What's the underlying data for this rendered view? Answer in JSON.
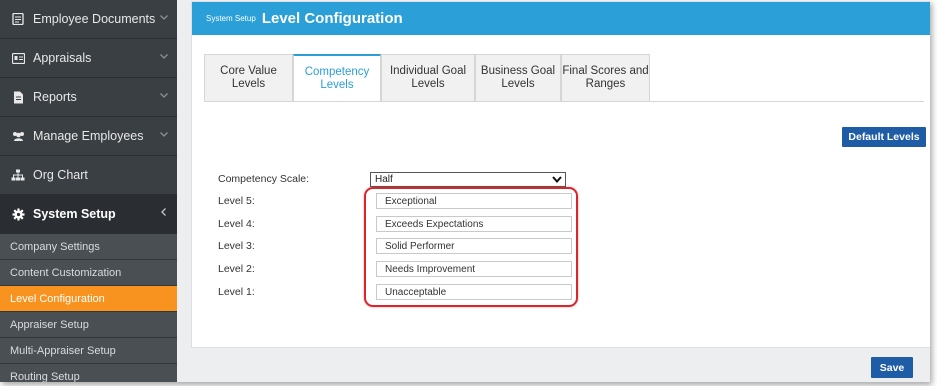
{
  "sidebar": {
    "items": [
      {
        "label": "Employee Documents",
        "icon": "document-icon",
        "expandable": true
      },
      {
        "label": "Appraisals",
        "icon": "id-card-icon",
        "expandable": true
      },
      {
        "label": "Reports",
        "icon": "report-icon",
        "expandable": true
      },
      {
        "label": "Manage Employees",
        "icon": "users-icon",
        "expandable": true
      },
      {
        "label": "Org Chart",
        "icon": "org-chart-icon",
        "expandable": false
      },
      {
        "label": "System Setup",
        "icon": "gear-icon",
        "expandable": true,
        "active": true
      }
    ],
    "sub_items": [
      "Company Settings",
      "Content Customization",
      "Level Configuration",
      "Appraiser Setup",
      "Multi-Appraiser Setup",
      "Routing Setup"
    ],
    "selected_sub_item": "Level Configuration"
  },
  "header": {
    "breadcrumb": "System Setup",
    "title": "Level Configuration"
  },
  "tabs": [
    {
      "line1": "Core Value",
      "line2": "Levels"
    },
    {
      "line1": "Competency",
      "line2": "Levels",
      "active": true
    },
    {
      "line1": "Individual Goal",
      "line2": "Levels"
    },
    {
      "line1": "Business Goal",
      "line2": "Levels"
    },
    {
      "line1": "Final Scores and",
      "line2": "Ranges"
    }
  ],
  "buttons": {
    "default_levels": "Default Levels",
    "save": "Save"
  },
  "form": {
    "scale_label": "Competency Scale:",
    "scale_value": "Half",
    "levels": [
      {
        "label": "Level 5:",
        "value": "Exceptional"
      },
      {
        "label": "Level 4:",
        "value": "Exceeds Expectations"
      },
      {
        "label": "Level 3:",
        "value": "Solid Performer"
      },
      {
        "label": "Level 2:",
        "value": "Needs Improvement"
      },
      {
        "label": "Level 1:",
        "value": "Unacceptable"
      }
    ]
  },
  "colors": {
    "header_blue": "#2a9fd8",
    "button_blue": "#1f5ca6",
    "sidebar_bg": "#3a3f44",
    "selected_orange": "#f7931e",
    "highlight_red": "#d9262c"
  }
}
